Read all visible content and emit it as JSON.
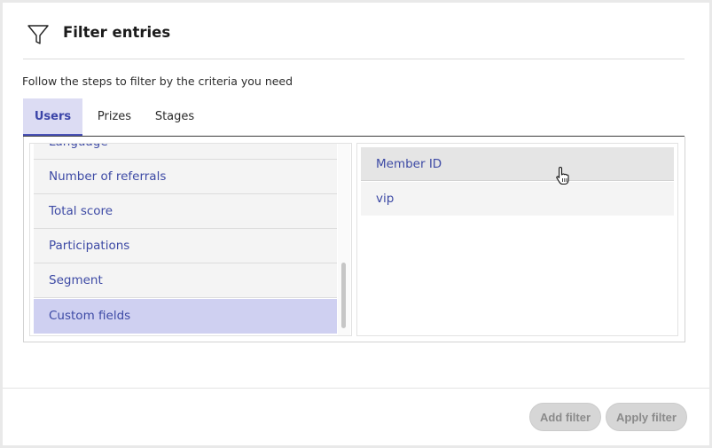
{
  "header": {
    "title": "Filter entries",
    "icon": "filter-funnel-icon"
  },
  "subtitle": "Follow the steps to filter by the criteria you need",
  "tabs": [
    {
      "label": "Users",
      "active": true
    },
    {
      "label": "Prizes",
      "active": false
    },
    {
      "label": "Stages",
      "active": false
    }
  ],
  "criteria": [
    {
      "label": "Language",
      "partially_visible": true
    },
    {
      "label": "Number of referrals"
    },
    {
      "label": "Total score"
    },
    {
      "label": "Participations"
    },
    {
      "label": "Segment"
    },
    {
      "label": "Custom fields",
      "selected": true
    }
  ],
  "fields": [
    {
      "label": "Member ID",
      "hovered": true
    },
    {
      "label": "vip"
    }
  ],
  "footer": {
    "add_filter": "Add filter",
    "apply_filter": "Apply filter"
  },
  "colors": {
    "accent": "#4951b8",
    "link_text": "#3d4aa5",
    "selected_bg": "#cfd0f1",
    "tab_active_bg": "#dcdcf3",
    "disabled_button": "#d6d6d6"
  }
}
